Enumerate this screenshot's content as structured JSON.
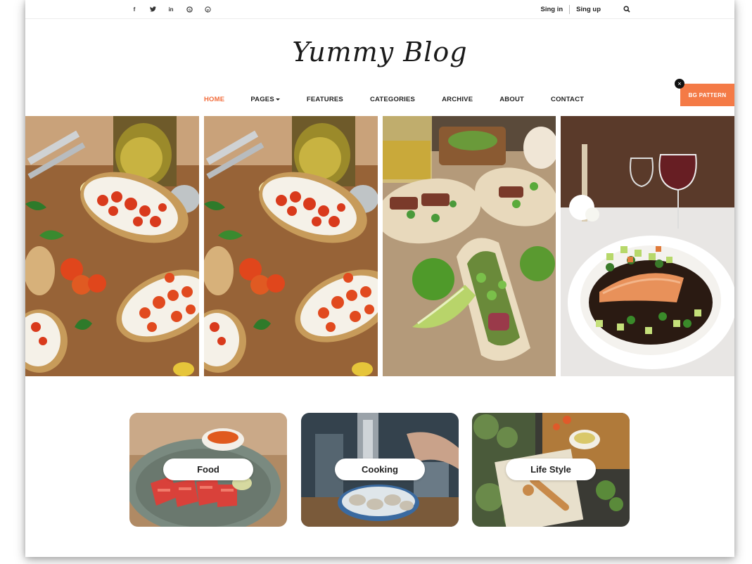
{
  "topbar": {
    "social_icons": [
      {
        "name": "facebook-icon",
        "glyph": "f"
      },
      {
        "name": "twitter-icon",
        "glyph": "❧"
      },
      {
        "name": "linkedin-icon",
        "glyph": "in"
      },
      {
        "name": "skype-icon",
        "glyph": "S"
      },
      {
        "name": "pinterest-icon",
        "glyph": "Ⓟ"
      }
    ],
    "signin_label": "Sing in",
    "signup_label": "Sing up"
  },
  "logo": "Yummy Blog",
  "nav": {
    "items": [
      "HOME",
      "PAGES",
      "FEATURES",
      "CATEGORIES",
      "ARCHIVE",
      "ABOUT",
      "CONTACT"
    ],
    "active_color": "#f26b3a"
  },
  "bg_pattern": {
    "label": "BG PATTERN",
    "close": "×",
    "color": "#f47a46"
  },
  "categories": [
    {
      "label": "Food"
    },
    {
      "label": "Cooking"
    },
    {
      "label": "Life Style"
    }
  ]
}
